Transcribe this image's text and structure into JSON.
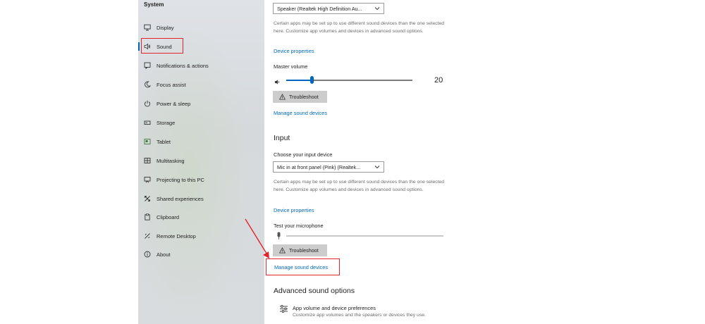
{
  "sidebar": {
    "title": "System",
    "items": [
      {
        "label": "Display",
        "icon": "monitor-icon"
      },
      {
        "label": "Sound",
        "icon": "speaker-icon"
      },
      {
        "label": "Notifications & actions",
        "icon": "notification-icon"
      },
      {
        "label": "Focus assist",
        "icon": "moon-icon"
      },
      {
        "label": "Power & sleep",
        "icon": "power-icon"
      },
      {
        "label": "Storage",
        "icon": "storage-icon"
      },
      {
        "label": "Tablet",
        "icon": "tablet-icon"
      },
      {
        "label": "Multitasking",
        "icon": "multitasking-icon"
      },
      {
        "label": "Projecting to this PC",
        "icon": "projecting-icon"
      },
      {
        "label": "Shared experiences",
        "icon": "shared-icon"
      },
      {
        "label": "Clipboard",
        "icon": "clipboard-icon"
      },
      {
        "label": "Remote Desktop",
        "icon": "remote-desktop-icon"
      },
      {
        "label": "About",
        "icon": "info-icon"
      }
    ],
    "selected": "Sound"
  },
  "output": {
    "device_selected": "Speaker (Realtek High Definition Au...",
    "note": "Certain apps may be set up to use different sound devices than the one selected here. Customize app volumes and devices in advanced sound options.",
    "device_properties": "Device properties",
    "master_volume_label": "Master volume",
    "master_volume_value": "20",
    "troubleshoot": "Troubleshoot",
    "manage_devices": "Manage sound devices"
  },
  "input": {
    "heading": "Input",
    "choose_label": "Choose your input device",
    "device_selected": "Mic in at front panel (Pink) (Realtek...",
    "note": "Certain apps may be set up to use different sound devices than the one selected here. Customize app volumes and devices in advanced sound options.",
    "device_properties": "Device properties",
    "test_mic_label": "Test your microphone",
    "troubleshoot": "Troubleshoot",
    "manage_devices": "Manage sound devices"
  },
  "advanced": {
    "heading": "Advanced sound options",
    "app_volume_title": "App volume and device preferences",
    "app_volume_desc": "Customize app volumes and the speakers or devices they use."
  },
  "colors": {
    "accent": "#0067c0",
    "highlight": "#e0242b",
    "sidebar_bg": "#dcdfe2"
  }
}
